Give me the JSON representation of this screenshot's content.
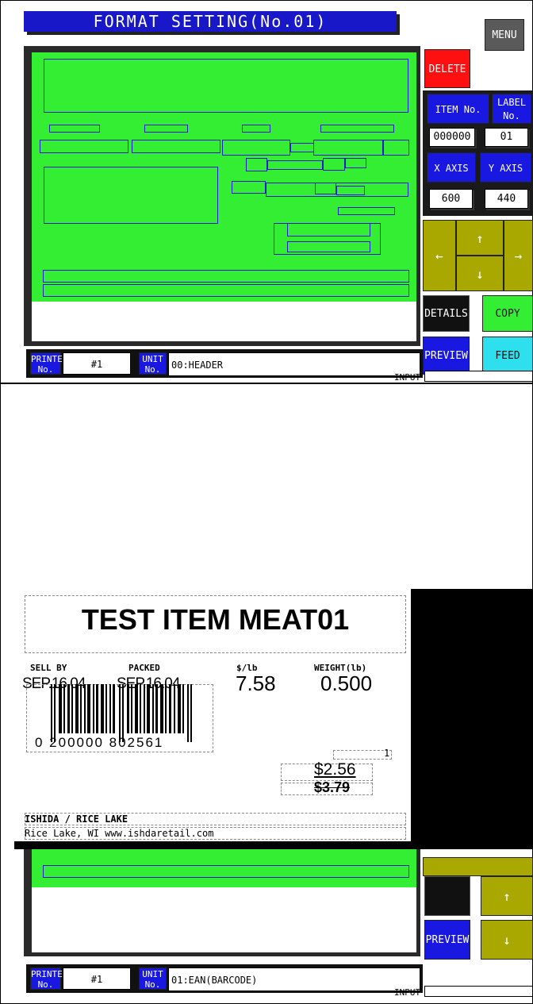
{
  "top": {
    "title": "FORMAT SETTING(No.01)",
    "menu_label": "MENU",
    "delete_label": "DELETE",
    "item_no_label": "ITEM No.",
    "label_no_label": "LABEL No.",
    "item_no_value": "000000",
    "label_no_value": "01",
    "x_axis_label": "X AXIS",
    "y_axis_label": "Y AXIS",
    "x_axis_value": "600",
    "y_axis_value": "440",
    "arrow_up": "↑",
    "arrow_down": "↓",
    "arrow_left": "←",
    "arrow_right": "→",
    "details_label": "DETAILS",
    "copy_label": "COPY",
    "preview_label": "PREVIEW",
    "feed_label": "FEED",
    "printer_no_label": "PRINTER No.",
    "printer_no_value": "#1",
    "unit_no_label": "UNIT No.",
    "unit_value": "00:HEADER",
    "input_label": "INPUT"
  },
  "bottom": {
    "preview_label": "PREVIEW",
    "arrow_up": "↑",
    "arrow_down": "↓",
    "printer_no_label": "PRINTER No.",
    "printer_no_value": "#1",
    "unit_no_label": "UNIT No.",
    "unit_value": "01:EAN(BARCODE)",
    "input_label": "INPUT"
  },
  "label_preview": {
    "item_name": "TEST ITEM MEAT01",
    "headers": [
      "SELL BY",
      "PACKED",
      "$/lb",
      "WEIGHT(lb)"
    ],
    "values": [
      "SEP.16.04",
      "SEP.16.04",
      "7.58",
      "0.500"
    ],
    "barcode_digits": "0 200000 802561",
    "count": "1",
    "price": "$2.56",
    "old_price": "$3.79",
    "store_line1": "ISHIDA / RICE LAKE",
    "store_line2": "Rice Lake, WI www.ishdaretail.com"
  },
  "colors": {
    "title_blue": "#1818c8",
    "canvas_green": "#33ee33",
    "delete_red": "#ff1010",
    "olive_arrow": "#a8a800",
    "feed_cyan": "#2ee0ee"
  }
}
